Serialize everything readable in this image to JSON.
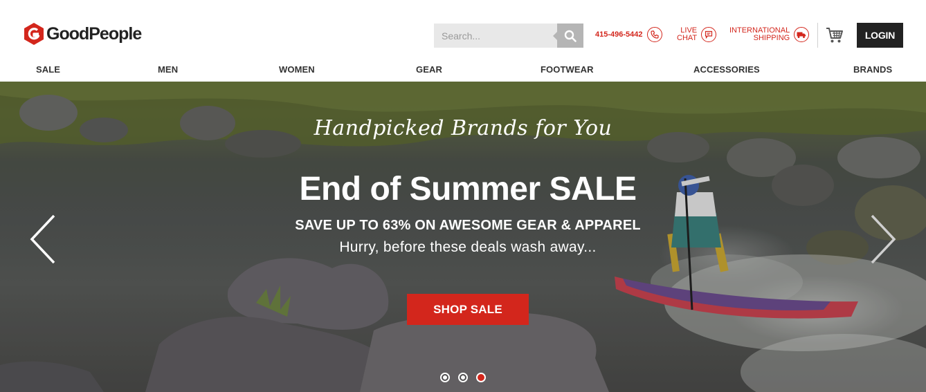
{
  "brand": {
    "name": "GoodPeople",
    "accent": "#d3261c"
  },
  "header": {
    "search_placeholder": "Search...",
    "phone": "415-496-5442",
    "chat_line1": "LIVE",
    "chat_line2": "CHAT",
    "shipping_line1": "INTERNATIONAL",
    "shipping_line2": "SHIPPING",
    "login_label": "LOGIN"
  },
  "nav": {
    "items": [
      {
        "label": "SALE"
      },
      {
        "label": "MEN"
      },
      {
        "label": "WOMEN"
      },
      {
        "label": "GEAR"
      },
      {
        "label": "FOOTWEAR"
      },
      {
        "label": "ACCESSORIES"
      },
      {
        "label": "BRANDS"
      }
    ]
  },
  "hero": {
    "tagline": "Handpicked Brands for You",
    "headline": "End of Summer SALE",
    "subhead": "SAVE UP TO 63% ON AWESOME GEAR & APPAREL",
    "subline": "Hurry, before these deals wash away...",
    "cta_label": "SHOP SALE",
    "slide_count": 3,
    "active_slide": 3
  },
  "icons": {
    "search": "search-icon",
    "phone": "phone-icon",
    "chat": "chat-icon",
    "shipping": "truck-icon",
    "cart": "cart-icon",
    "prev": "chevron-left-icon",
    "next": "chevron-right-icon"
  }
}
